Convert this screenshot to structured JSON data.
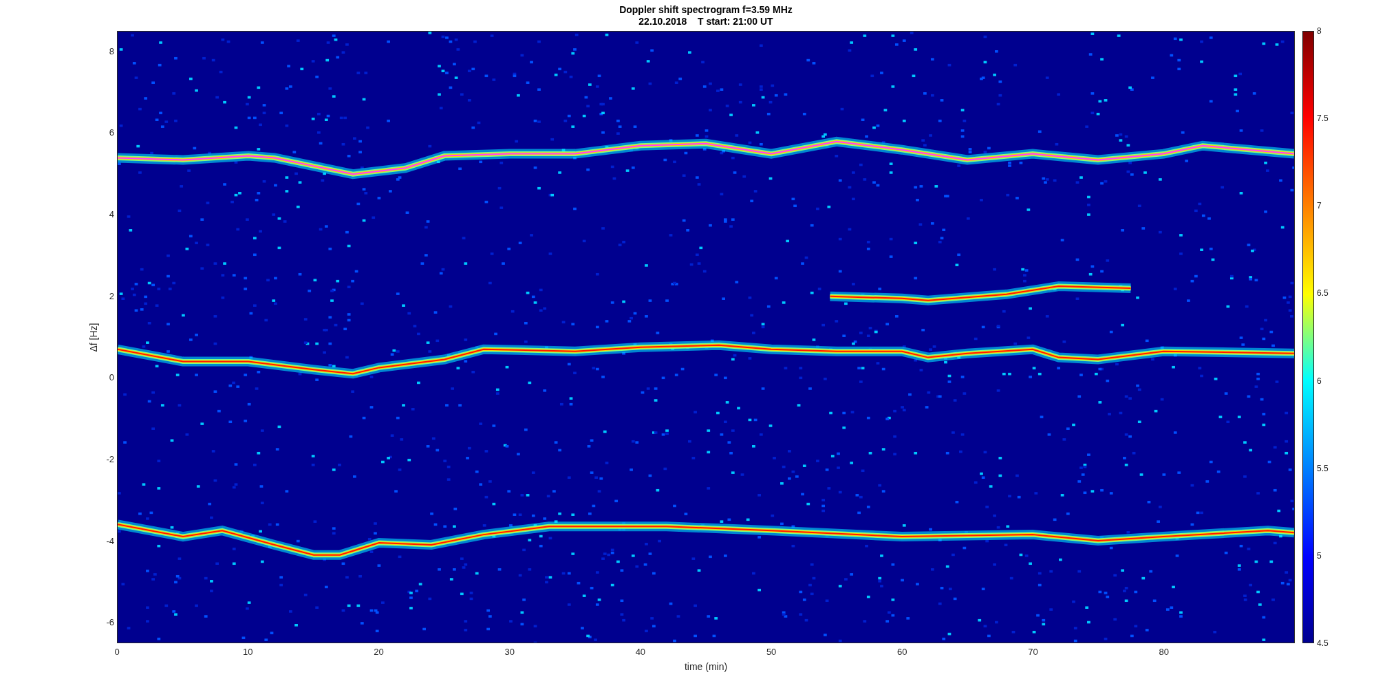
{
  "figure": {
    "title_lines": [
      "Doppler shift spectrogram f=3.59 MHz",
      "22.10.2018    T start: 21:00 UT"
    ],
    "ylabel": "Δf [Hz]",
    "xlabel": "time (min)",
    "xticks": [
      "0",
      "10",
      "20",
      "30",
      "40",
      "50",
      "60",
      "70",
      "80"
    ],
    "yticks": [
      "8",
      "6",
      "4",
      "2",
      "0",
      "-2",
      "-4",
      "-6"
    ],
    "colorbar_ticks": [
      "8",
      "7.5",
      "7",
      "6.5",
      "6",
      "5.5",
      "5",
      "4.5"
    ]
  }
}
